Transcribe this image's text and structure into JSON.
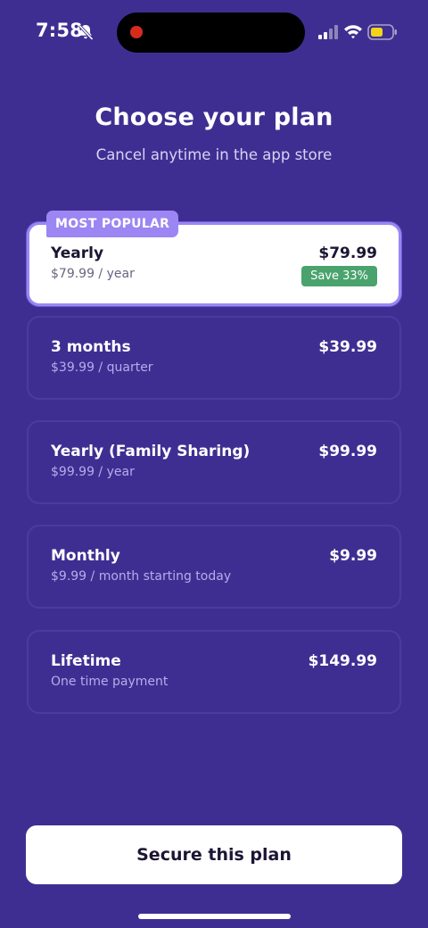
{
  "status_bar": {
    "time": "7:58",
    "icons": [
      "bell-slash-icon",
      "signal-icon",
      "wifi-icon",
      "battery-icon"
    ],
    "battery_color": "#f2d31b"
  },
  "header": {
    "title": "Choose your plan",
    "subtitle": "Cancel anytime in the app store"
  },
  "plans": [
    {
      "name": "Yearly",
      "detail": "$79.99 / year",
      "price": "$79.99",
      "badge": "Save 33%",
      "tag": "MOST POPULAR",
      "selected": true
    },
    {
      "name": "3 months",
      "detail": "$39.99 / quarter",
      "price": "$39.99",
      "selected": false
    },
    {
      "name": "Yearly (Family Sharing)",
      "detail": "$99.99 / year",
      "price": "$99.99",
      "selected": false
    },
    {
      "name": "Monthly",
      "detail": "$9.99 / month starting today",
      "price": "$9.99",
      "selected": false
    },
    {
      "name": "Lifetime",
      "detail": "One time payment",
      "price": "$149.99",
      "selected": false
    }
  ],
  "cta": {
    "label": "Secure this plan"
  },
  "colors": {
    "background": "#3f2e92",
    "accent": "#9b86f3",
    "save_badge": "#4aa36d",
    "card_border": "#4b3ba0"
  }
}
